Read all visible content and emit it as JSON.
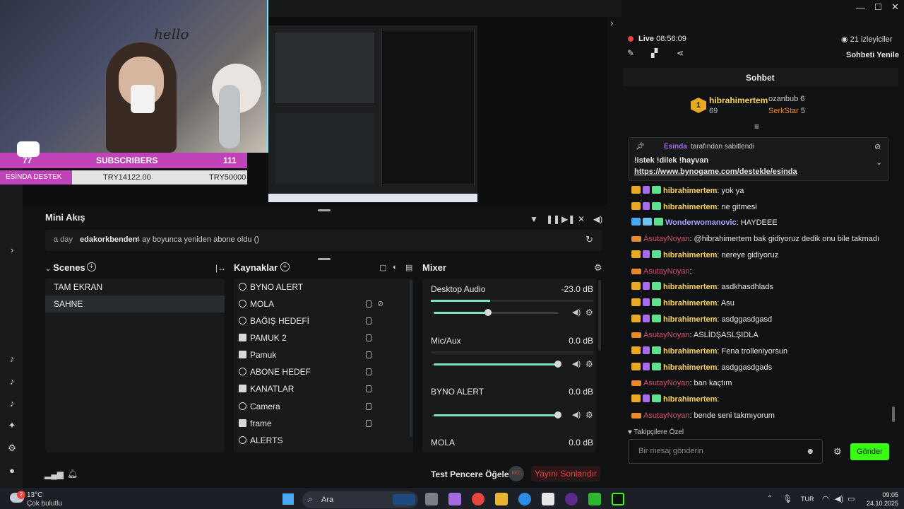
{
  "window": {
    "controls": [
      "—",
      "☐",
      "✕"
    ]
  },
  "overlay": {
    "subscribers_count_left": "77",
    "subscribers_label": "SUBSCRIBERS",
    "subscribers_goal": "111",
    "destek_label": "ESİNDA DESTEK",
    "destek_current": "TRY14122.00",
    "destek_goal": "TRY50000",
    "hello_text": "hello"
  },
  "mini_akis": {
    "title": "Mini Akış",
    "event": {
      "time": "a day",
      "user": "edakorkbenden",
      "text": "4 ay boyunca yeniden abone oldu ()"
    }
  },
  "scenes": {
    "title": "Scenes",
    "items": [
      {
        "label": "TAM EKRAN",
        "selected": false
      },
      {
        "label": "SAHNE",
        "selected": true
      }
    ]
  },
  "sources": {
    "title": "Kaynaklar",
    "items": [
      {
        "label": "BYNO ALERT",
        "icon": "globe-icon",
        "locked": false
      },
      {
        "label": "MOLA",
        "icon": "globe-icon",
        "locked": true
      },
      {
        "label": "BAĞIŞ HEDEFİ",
        "icon": "globe-icon",
        "locked": true
      },
      {
        "label": "PAMUK 2",
        "icon": "image-icon",
        "locked": true
      },
      {
        "label": "Pamuk",
        "icon": "image-icon",
        "locked": true
      },
      {
        "label": "ABONE HEDEF",
        "icon": "globe-icon",
        "locked": true
      },
      {
        "label": "KANATLAR",
        "icon": "image-icon",
        "locked": true
      },
      {
        "label": "Camera",
        "icon": "camera-icon",
        "locked": true
      },
      {
        "label": "frame",
        "icon": "image-icon",
        "locked": true
      },
      {
        "label": "ALERTS",
        "icon": "globe-icon",
        "locked": false
      }
    ]
  },
  "mixer": {
    "title": "Mixer",
    "channels": [
      {
        "name": "Desktop Audio",
        "db": "-23.0 dB",
        "level": 0.3
      },
      {
        "name": "Mic/Aux",
        "db": "0.0 dB",
        "level": 1.0
      },
      {
        "name": "BYNO ALERT",
        "db": "0.0 dB",
        "level": 1.0
      },
      {
        "name": "MOLA",
        "db": "0.0 dB",
        "level": 1.0
      }
    ]
  },
  "bottom": {
    "test_label": "Test Pencere Öğeleri",
    "rec_label": "REC",
    "end_stream_label": "Yayını Sonlandır"
  },
  "live": {
    "status": "Live",
    "time": "08:56:09",
    "viewers": "21 izleyiciler",
    "refresh_chat": "Sohbeti Yenile"
  },
  "chat": {
    "header": "Sohbet",
    "top_user": "hibrahimertem",
    "top_user_count": "69",
    "rank": "1",
    "second_user": "ozanbub",
    "second_count": "6",
    "third_user": "SerkStar",
    "third_count": "5",
    "pinned_by": "Esinda",
    "pinned_suffix": "tarafından sabitlendi",
    "pinned_text": "!istek !dilek !hayvan",
    "pinned_link": "https://www.bynogame.com/destekle/esinda",
    "messages": [
      {
        "user": "hibrahimertem",
        "type": "h",
        "text": ": yok ya"
      },
      {
        "user": "hibrahimertem",
        "type": "h",
        "text": ": ne gitmesi"
      },
      {
        "user": "Wonderwomanovic",
        "type": "w",
        "text": ": HAYDEEE"
      },
      {
        "user": "AsutayNoyan",
        "type": "a",
        "text": ": @hibrahimertem bak gidiyoruz dedik onu bile takmadı"
      },
      {
        "user": "hibrahimertem",
        "type": "h",
        "text": ": nereye gidiyoruz"
      },
      {
        "user": "AsutayNoyan",
        "type": "a",
        "text": ":"
      },
      {
        "user": "hibrahimertem",
        "type": "h",
        "text": ": asdkhasdhlads"
      },
      {
        "user": "hibrahimertem",
        "type": "h",
        "text": ": Asu"
      },
      {
        "user": "hibrahimertem",
        "type": "h",
        "text": ": asdggasdgasd"
      },
      {
        "user": "AsutayNoyan",
        "type": "a",
        "text": ": ASLİDŞASLŞIDLA"
      },
      {
        "user": "hibrahimertem",
        "type": "h",
        "text": ": Fena trolleniyorsun"
      },
      {
        "user": "hibrahimertem",
        "type": "h",
        "text": ": asdggasdgads"
      },
      {
        "user": "AsutayNoyan",
        "type": "a",
        "text": ": ban kaçtım"
      },
      {
        "user": "hibrahimertem",
        "type": "h",
        "text": ":"
      },
      {
        "user": "AsutayNoyan",
        "type": "a",
        "text": ": bende seni takmıyorum"
      }
    ],
    "followers_only": "Takipçilere Özel",
    "input_placeholder": "Bir mesaj gönderin",
    "send_label": "Gönder"
  },
  "taskbar": {
    "weather_temp": "13°C",
    "weather_desc": "Çok bulutlu",
    "notif_count": "2",
    "search_label": "Ara",
    "lang": "TUR",
    "time": "09:05",
    "date": "24.10.2025"
  },
  "colors": {
    "accent_green": "#39ff14",
    "mixer_green": "#7ce3c4",
    "live_red": "#e8453c",
    "end_red": "#e8453c",
    "sub_pink": "#c043b8"
  }
}
